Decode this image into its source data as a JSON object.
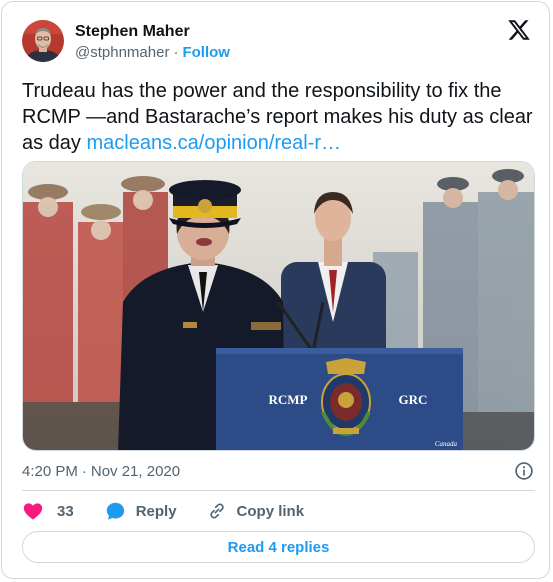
{
  "author": {
    "name": "Stephen Maher",
    "handle": "@stphnmaher",
    "separator": "·",
    "follow_label": "Follow"
  },
  "tweet": {
    "text": "Trudeau has the power and the responsibility to fix the RCMP —and Bastarache’s report makes his duty as clear as day ",
    "link_text": "macleans.ca/opinion/real-r…"
  },
  "media": {
    "podium_left_text": "RCMP",
    "podium_right_text": "GRC",
    "podium_corner_text": "Canada"
  },
  "meta": {
    "time": "4:20 PM",
    "separator": "·",
    "date": "Nov 21, 2020"
  },
  "actions": {
    "like_count": "33",
    "reply_label": "Reply",
    "copy_label": "Copy link"
  },
  "read_replies_label": "Read 4 replies",
  "colors": {
    "accent": "#1d9bf0",
    "like": "#f91880",
    "text": "#0f1419",
    "muted": "#536471",
    "border": "#cfd9de"
  }
}
